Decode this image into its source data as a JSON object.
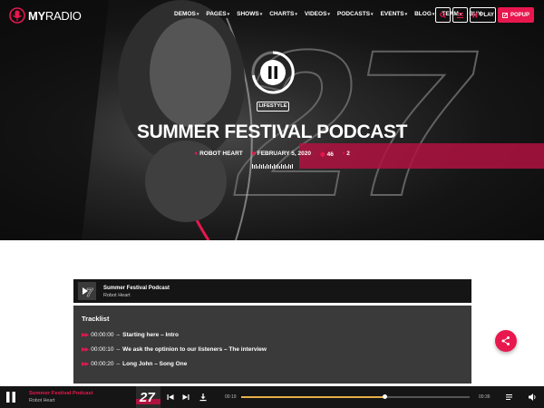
{
  "brand": {
    "name_a": "MY",
    "name_b": "RADIO",
    "accent": "#e8174e"
  },
  "nav": {
    "items": [
      {
        "label": "DEMOS",
        "has_submenu": true
      },
      {
        "label": "PAGES",
        "has_submenu": true
      },
      {
        "label": "SHOWS",
        "has_submenu": true
      },
      {
        "label": "CHARTS",
        "has_submenu": true
      },
      {
        "label": "VIDEOS",
        "has_submenu": true
      },
      {
        "label": "PODCASTS",
        "has_submenu": true
      },
      {
        "label": "EVENTS",
        "has_submenu": true
      },
      {
        "label": "BLOG",
        "has_submenu": true
      },
      {
        "label": "TEAM",
        "has_submenu": true
      },
      {
        "label": "BUY",
        "has_submenu": false
      }
    ],
    "play_label": "PLAY",
    "popup_label": "POPUP"
  },
  "hero": {
    "category": "LIFESTYLE",
    "title": "SUMMER FESTIVAL PODCAST",
    "author": "ROBOT HEART",
    "date": "FEBRUARY 5, 2020",
    "views": "46",
    "comments": "2",
    "artwork_number": "27"
  },
  "episode": {
    "title": "Summer Festival Podcast",
    "artist": "Robot Heart"
  },
  "tracklist": {
    "heading": "Tracklist",
    "tracks": [
      {
        "time": "00:00:00",
        "name": "Starting here – Intro"
      },
      {
        "time": "00:00:10",
        "name": "We ask the optinion to our listeners – The interview"
      },
      {
        "time": "00:00:20",
        "name": "Long John – Song One"
      }
    ]
  },
  "player": {
    "title": "Summer Festival Podcast",
    "artist": "Robot Heart",
    "current_time": "00:19",
    "duration": "00:36",
    "progress": 0.63,
    "thumb_number": "27"
  }
}
